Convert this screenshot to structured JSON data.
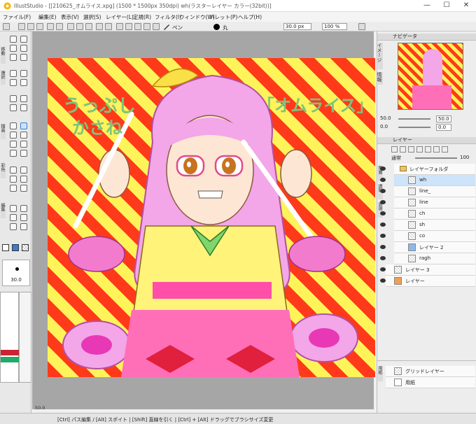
{
  "window": {
    "title": "IllustStudio - [[210625_オムライス.xpg] (1500 * 1500px 350dpi)  wh(ラスターレイヤー カラー(32bit))]",
    "minimize": "—",
    "maximize": "☐",
    "close": "✕"
  },
  "menu": [
    "ファイル(F)",
    "編集(E)",
    "表示(V)",
    "選択(S)",
    "レイヤー(L)",
    "定規(R)",
    "フィルタ(I)",
    "ウィンドウ(W)",
    "パレット(P)",
    "ヘルプ(H)"
  ],
  "toolbar": {
    "brush_label": "ペン",
    "shape_label": "丸",
    "size_value": "30.0 px",
    "opacity_value": "100 %"
  },
  "tool_panel": {
    "group_labels": [
      "移動",
      "選択",
      "描画",
      "彩色",
      "編集"
    ],
    "brush_size": "30.0"
  },
  "canvas_area": {
    "zoom": "50.0"
  },
  "artwork": {
    "text_left_line1": "うっぷし",
    "text_left_line2": "かさね",
    "text_right": "「オムライス」"
  },
  "navigator": {
    "title": "ナビゲータ",
    "side_label": "イメージ",
    "side_label2": "情報",
    "zoom": "50.0",
    "rotation": "0.0"
  },
  "layers_panel": {
    "title": "レイヤー",
    "blend_mode": "通常",
    "opacity": "100",
    "side_labels": [
      "階層",
      "透明",
      "表現"
    ],
    "layers": [
      {
        "name": "レイヤーフォルダ",
        "folder": true,
        "indent": 0
      },
      {
        "name": "wh",
        "selected": true,
        "indent": 1
      },
      {
        "name": "line_",
        "indent": 1
      },
      {
        "name": "line",
        "indent": 1
      },
      {
        "name": "ch",
        "indent": 1
      },
      {
        "name": "sh",
        "indent": 1
      },
      {
        "name": "co",
        "indent": 1
      },
      {
        "name": "レイヤー 2",
        "indent": 1
      },
      {
        "name": "ragh",
        "indent": 1
      },
      {
        "name": "レイヤー 3",
        "indent": 0
      },
      {
        "name": "レイヤー",
        "indent": 0
      }
    ],
    "paper_label": "用紙",
    "grid_layer": "グリッドレイヤー",
    "paper_layer": "用紙"
  },
  "status": {
    "message": "[Ctrl] パス編集 / [Alt] スポイト | [Shift] 直線を引く | [Ctrl] + [Alt] ドラッグでブラシサイズ変更"
  },
  "colors": {
    "accent_selected": "#cde4fa",
    "stripe_red": "#ff3a1a",
    "stripe_yellow": "#fff35a",
    "hair_pink": "#f3a6e8",
    "text_green": "#7fc47a"
  }
}
